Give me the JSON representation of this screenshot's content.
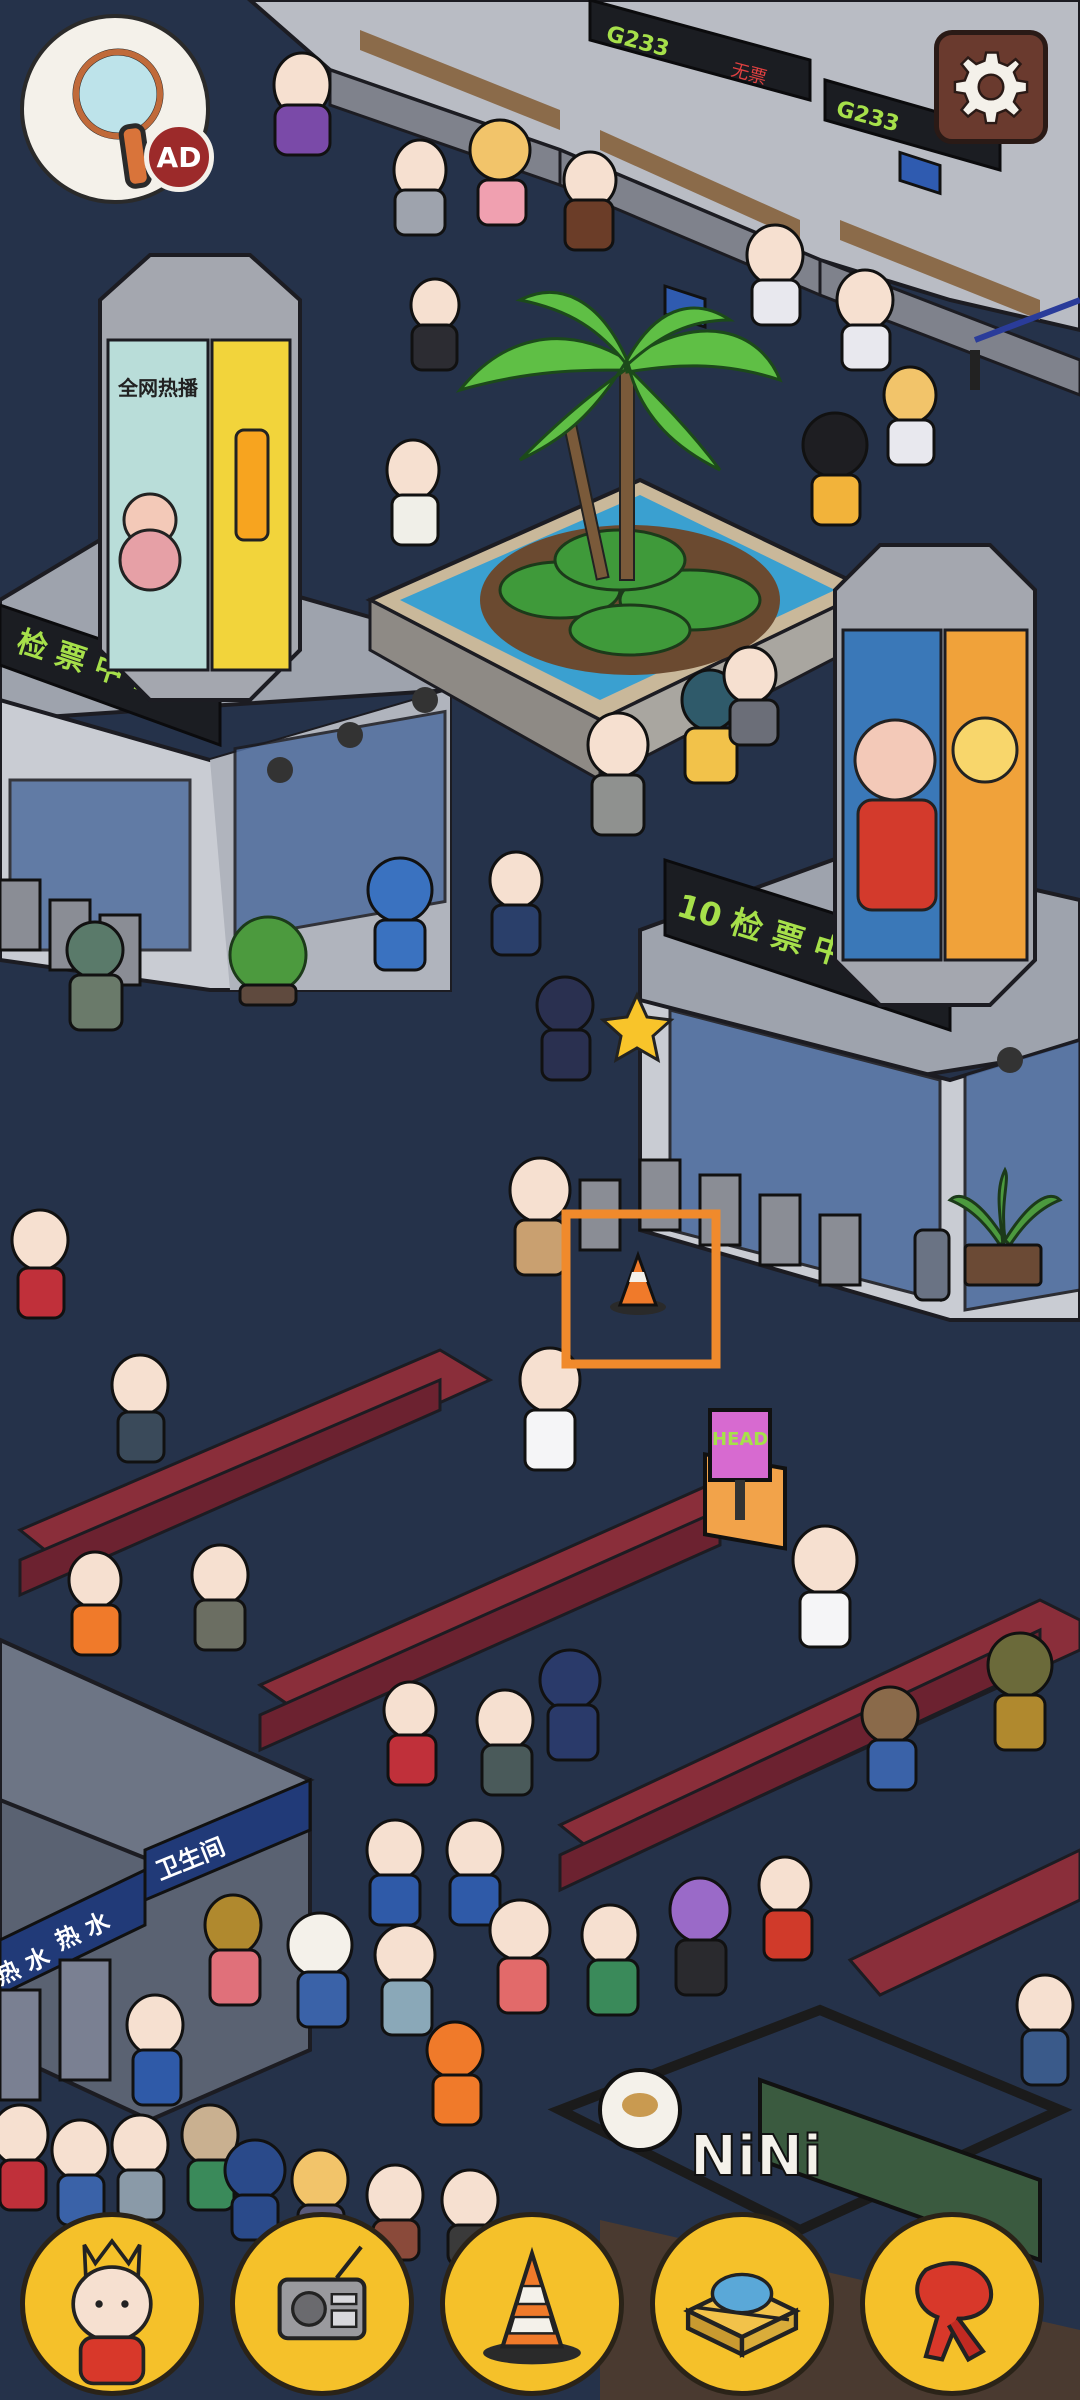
{
  "hud": {
    "hint_badge": "AD",
    "hint_icon": "magnifier-icon",
    "settings_icon": "gear-icon"
  },
  "scene": {
    "gate_sign_left": "检 票 中 11",
    "gate_sign_right": "10 检 票 中 9",
    "screen_code_1": "G233",
    "screen_code_2": "G233",
    "screen_status": "无票",
    "ad_panel_text": "全网热播",
    "toilet_sign": "卫生间",
    "water_sign_1": "热 水",
    "water_sign_2": "热 水",
    "cafe_name": "NiNi",
    "digital_board_text": "HEAD"
  },
  "tray": {
    "items": [
      {
        "name": "character-king",
        "icon": "king-character-icon"
      },
      {
        "name": "radio",
        "icon": "radio-icon"
      },
      {
        "name": "traffic-cone",
        "icon": "traffic-cone-icon"
      },
      {
        "name": "luggage",
        "icon": "luggage-icon"
      },
      {
        "name": "red-scarf",
        "icon": "red-scarf-icon"
      }
    ]
  },
  "found_marker": {
    "target": "traffic-cone",
    "color": "#f08a2c"
  },
  "colors": {
    "floor": "#25324a",
    "tray_button": "#f5c12a",
    "seat": "#8a2e3a",
    "sign_text": "#a6e04a",
    "highlight": "#f08a2c",
    "settings_bg": "#6a3a2e"
  }
}
